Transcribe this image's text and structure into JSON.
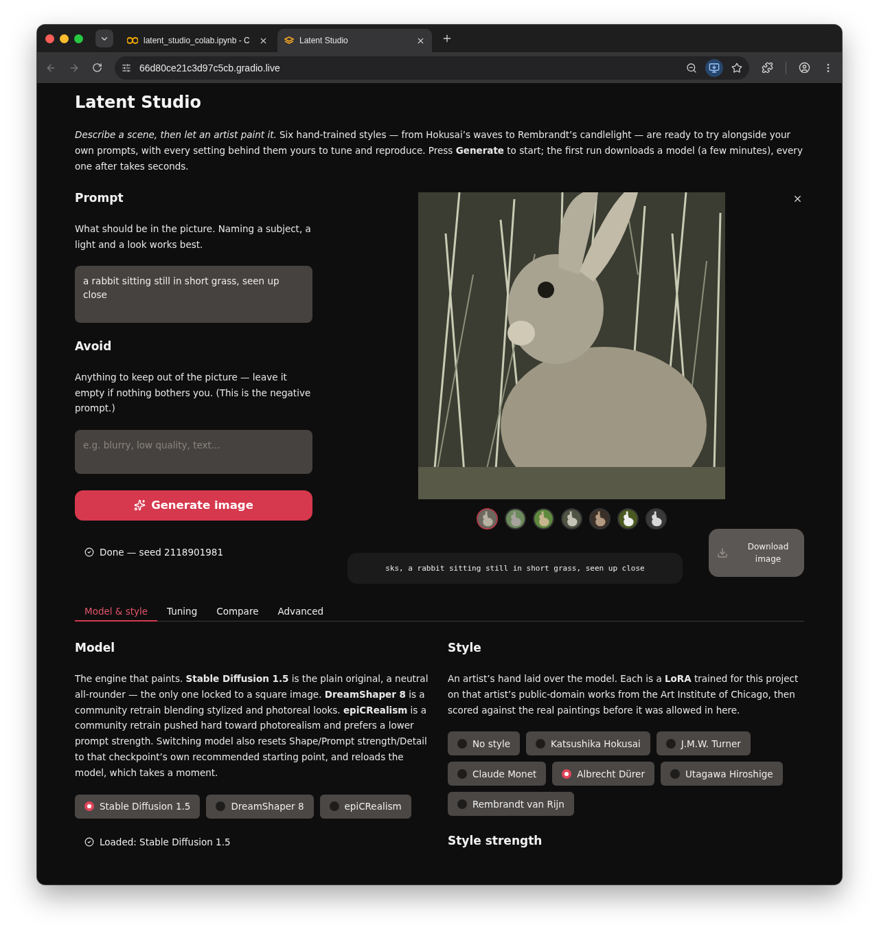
{
  "browser": {
    "tabs": [
      {
        "title": "latent_studio_colab.ipynb - C",
        "selected": false
      },
      {
        "title": "Latent Studio",
        "selected": true
      }
    ],
    "address": "66d80ce21c3d97c5cb.gradio.live"
  },
  "page": {
    "title": "Latent Studio",
    "intro": "*Describe a scene, then let an artist paint it.* Six hand-trained styles — from Hokusai’s waves to Rembrandt’s candlelight — are ready to try alongside your own prompts, with every setting behind them yours to tune and reproduce. Press **Generate** to start; the first run downloads a model (a few minutes), every one after takes seconds."
  },
  "prompt": {
    "heading": "Prompt",
    "hint": "What should be in the picture. Naming a subject, a light and a look works best.",
    "value": "a rabbit sitting still in short grass, seen up close"
  },
  "avoid": {
    "heading": "Avoid",
    "hint": "Anything to keep out of the picture — leave it empty if nothing bothers you. (This is the negative prompt.)",
    "placeholder": "e.g. blurry, low quality, text..."
  },
  "generate_button": "Generate image",
  "status": "Done — seed 2118901981",
  "gallery": {
    "thumbnails": [
      {
        "selected": true
      },
      {
        "selected": false
      },
      {
        "selected": false
      },
      {
        "selected": false
      },
      {
        "selected": false
      },
      {
        "selected": false
      },
      {
        "selected": false
      }
    ],
    "caption": "sks, a rabbit sitting still in short grass, seen up close",
    "download_button": "Download image"
  },
  "tabs": [
    {
      "label": "Model & style",
      "selected": true
    },
    {
      "label": "Tuning",
      "selected": false
    },
    {
      "label": "Compare",
      "selected": false
    },
    {
      "label": "Advanced",
      "selected": false
    }
  ],
  "model": {
    "heading": "Model",
    "description": "The engine that paints. **Stable Diffusion 1.5** is the plain original, a neutral all-rounder — the only one locked to a square image. **DreamShaper 8** is a community retrain blending stylized and photoreal looks. **epiCRealism** is a community retrain pushed hard toward photorealism and prefers a lower prompt strength. Switching model also resets Shape/Prompt strength/Detail to that checkpoint’s own recommended starting point, and reloads the model, which takes a moment.",
    "options": [
      {
        "label": "Stable Diffusion 1.5",
        "selected": true
      },
      {
        "label": "DreamShaper 8",
        "selected": false
      },
      {
        "label": "epiCRealism",
        "selected": false
      }
    ],
    "status": "Loaded: Stable Diffusion 1.5"
  },
  "style": {
    "heading": "Style",
    "description": "An artist’s hand laid over the model. Each is a **LoRA** trained for this project on that artist’s public-domain works from the Art Institute of Chicago, then scored against the real paintings before it was allowed in here.",
    "options": [
      {
        "label": "No style",
        "selected": false
      },
      {
        "label": "Katsushika Hokusai",
        "selected": false
      },
      {
        "label": "J.M.W. Turner",
        "selected": false
      },
      {
        "label": "Claude Monet",
        "selected": false
      },
      {
        "label": "Albrecht Dürer",
        "selected": true
      },
      {
        "label": "Utagawa Hiroshige",
        "selected": false
      },
      {
        "label": "Rembrandt van Rijn",
        "selected": false
      }
    ]
  },
  "style_strength": {
    "heading": "Style strength"
  }
}
